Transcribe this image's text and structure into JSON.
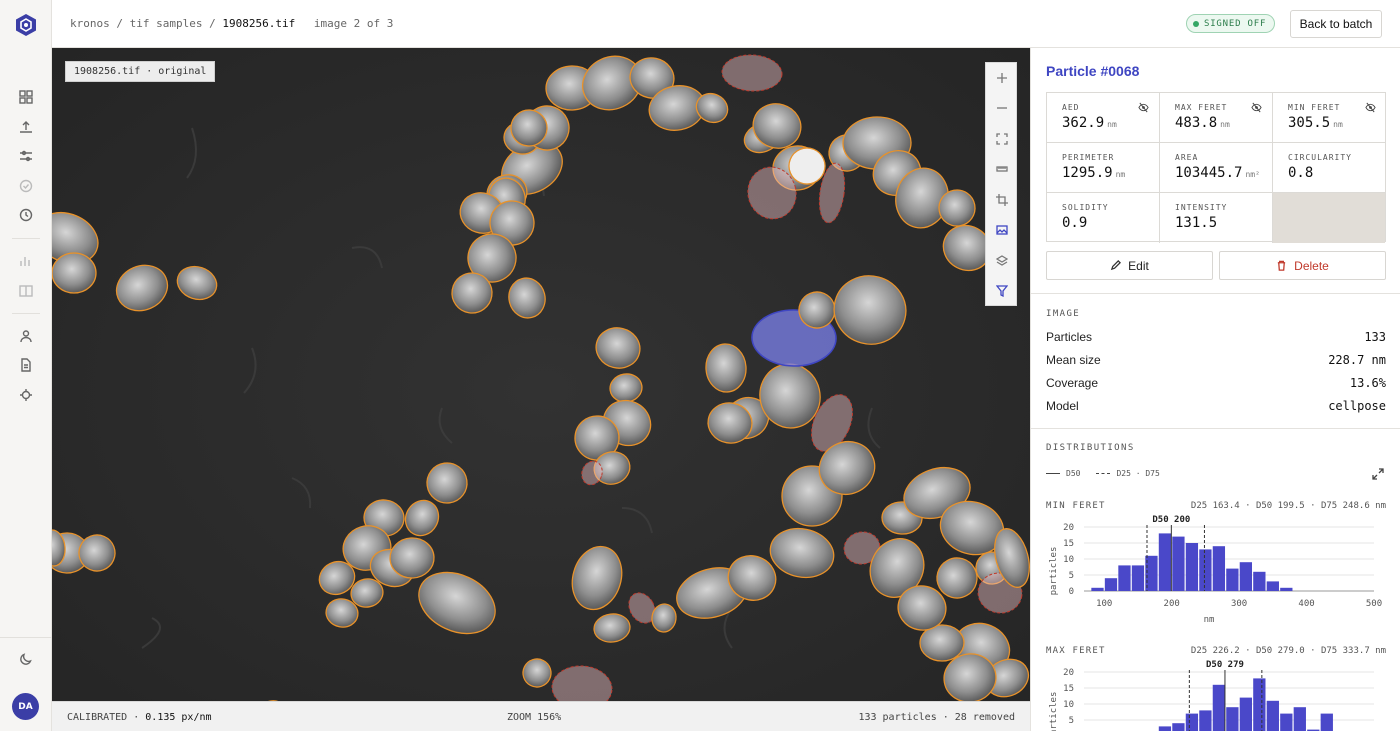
{
  "header": {
    "crumb_project": "kronos",
    "crumb_folder": "tif samples",
    "crumb_file": "1908256.tif",
    "image_count": "image 2 of 3",
    "status_badge": "SIGNED OFF",
    "back_button": "Back to batch"
  },
  "user": {
    "initials": "DA"
  },
  "viewer": {
    "image_label": "1908256.tif · original",
    "calibration_label": "CALIBRATED",
    "calibration_value": "0.135 px/nm",
    "zoom": "ZOOM 156%",
    "particle_summary": "133 particles · 28 removed"
  },
  "particle": {
    "title": "Particle #0068",
    "metrics": [
      {
        "label": "AED",
        "value": "362.9",
        "unit": "nm"
      },
      {
        "label": "MAX FERET",
        "value": "483.8",
        "unit": "nm"
      },
      {
        "label": "MIN FERET",
        "value": "305.5",
        "unit": "nm"
      },
      {
        "label": "PERIMETER",
        "value": "1295.9",
        "unit": "nm"
      },
      {
        "label": "AREA",
        "value": "103445.7",
        "unit": "nm²"
      },
      {
        "label": "CIRCULARITY",
        "value": "0.8",
        "unit": ""
      },
      {
        "label": "SOLIDITY",
        "value": "0.9",
        "unit": ""
      },
      {
        "label": "INTENSITY",
        "value": "131.5",
        "unit": ""
      }
    ],
    "edit_label": "Edit",
    "delete_label": "Delete"
  },
  "image_section": {
    "heading": "IMAGE",
    "rows": [
      {
        "label": "Particles",
        "value": "133"
      },
      {
        "label": "Mean size",
        "value": "228.7 nm"
      },
      {
        "label": "Coverage",
        "value": "13.6%"
      },
      {
        "label": "Model",
        "value": "cellpose"
      }
    ]
  },
  "distributions": {
    "heading": "DISTRIBUTIONS",
    "legend_solid": "D50",
    "legend_dashed": "D25 · D75"
  },
  "colors": {
    "accent": "#3f46c2",
    "bar": "#4a48c9",
    "outline": "#e8922a",
    "removed": "#c0392b"
  },
  "chart_data": [
    {
      "type": "bar",
      "title": "MIN FERET",
      "stats": "D25 163.4 · D50 199.5 · D75 248.6 nm",
      "marker_label": "D50 200",
      "xlabel": "nm",
      "ylabel": "particles",
      "x_ticks": [
        "100",
        "200",
        "300",
        "400",
        "500"
      ],
      "y_ticks": [
        "0",
        "5",
        "10",
        "15",
        "20"
      ],
      "xlim": [
        70,
        500
      ],
      "ylim": [
        0,
        20
      ],
      "bin_width": 20,
      "bin_starts": [
        80,
        100,
        120,
        140,
        160,
        180,
        200,
        220,
        240,
        260,
        280,
        300,
        320,
        340,
        360,
        380
      ],
      "values": [
        1,
        4,
        8,
        8,
        11,
        18,
        17,
        15,
        13,
        14,
        7,
        9,
        6,
        3,
        1,
        0
      ],
      "d25": 163.4,
      "d50": 199.5,
      "d75": 248.6
    },
    {
      "type": "bar",
      "title": "MAX FERET",
      "stats": "D25 226.2 · D50 279.0 · D75 333.7 nm",
      "marker_label": "D50 279",
      "xlabel": "",
      "ylabel": "particles",
      "x_ticks": [],
      "y_ticks": [
        "5",
        "10",
        "15",
        "20"
      ],
      "xlim": [
        70,
        500
      ],
      "ylim": [
        0,
        20
      ],
      "bin_width": 20,
      "bin_starts": [
        180,
        200,
        220,
        240,
        260,
        280,
        300,
        320,
        340,
        360,
        380,
        400
      ],
      "values": [
        3,
        4,
        7,
        8,
        16,
        9,
        12,
        18,
        11,
        7,
        9,
        2
      ],
      "extra_bar": {
        "start": 420,
        "value": 7
      },
      "d25": 226.2,
      "d50": 279.0,
      "d75": 333.7
    }
  ]
}
